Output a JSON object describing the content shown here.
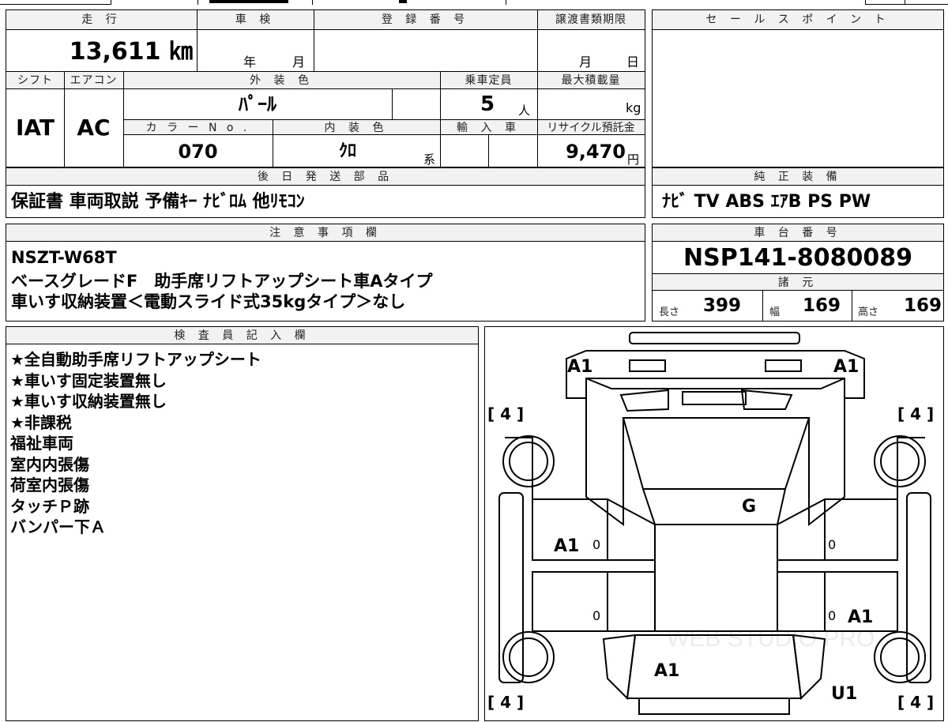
{
  "top_strip": {
    "cut_text": "..."
  },
  "headers": {
    "mileage": "走 行",
    "inspection": "車 検",
    "registration": "登 録 番 号",
    "transfer_deadline": "譲渡書類期限",
    "sales_points": "セ ー ル ス ポ イ ン ト",
    "shift": "シフト",
    "aircon": "エアコン",
    "exterior_color": "外 装 色",
    "capacity": "乗車定員",
    "max_load": "最大積載量",
    "color_no": "カ ラ ー N o .",
    "interior_color": "内 装 色",
    "import": "輸 入 車",
    "recycle": "リサイクル預託金",
    "later_parts": "後 日 発 送 部 品",
    "genuine_equipment": "純 正 装 備",
    "notes": "注 意 事 項 欄",
    "chassis_no": "車 台 番 号",
    "specs": "諸 元",
    "inspector_notes": "検 査 員 記 入 欄"
  },
  "values": {
    "mileage": "13,611 ㎞",
    "inspection_year": "年",
    "inspection_month": "月",
    "transfer_month": "月",
    "transfer_day": "日",
    "shift": "IAT",
    "aircon": "AC",
    "exterior_color": "ﾊﾟｰﾙ",
    "capacity": "5",
    "capacity_unit": "人",
    "max_load_unit": "kg",
    "color_no": "070",
    "interior_color": "ｸﾛ",
    "interior_suffix": "系",
    "recycle": "9,470",
    "recycle_unit": "円",
    "later_parts": "保証書 車両取説 予備ｷｰ ﾅﾋﾞﾛﾑ 他ﾘﾓｺﾝ",
    "genuine_equipment": "ﾅﾋﾞ TV ABS ｴｱB PS PW",
    "chassis_no": "NSP141-8080089",
    "length_label": "長さ",
    "length": "399",
    "width_label": "幅",
    "width": "169",
    "height_label": "高さ",
    "height": "169"
  },
  "notes_lines": [
    "NSZT-W68T",
    "ベースグレードF　助手席リフトアップシート車Aタイプ",
    "車いす収納装置＜電動スライド式35kgタイプ＞なし"
  ],
  "inspector_lines": [
    "★全自動助手席リフトアップシート",
    "★車いす固定装置無し",
    "★車いす収納装置無し",
    "★非課税",
    "福祉車両",
    "室内内張傷",
    "荷室内張傷",
    "タッチＰ跡",
    "バンパー下Ａ"
  ],
  "diagram": {
    "tire_label": "[ 4 ]",
    "marks": {
      "front_left": "A1",
      "front_right": "A1",
      "windshield": "G",
      "left_front_door": "A1",
      "right_rear_door": "A1",
      "rear_center": "A1",
      "rear_right": "U1",
      "zero": "0"
    },
    "watermark": "WEB STUDIO PRO"
  }
}
